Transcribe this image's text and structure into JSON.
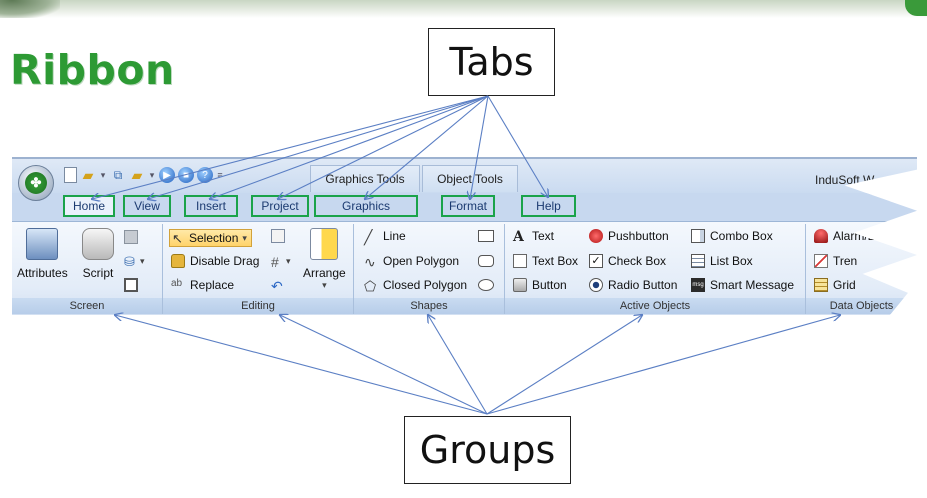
{
  "slide": {
    "title": "Ribbon",
    "callout_tabs": "Tabs",
    "callout_groups": "Groups"
  },
  "window": {
    "app_title": "InduSoft W",
    "context_tabs": [
      "Graphics Tools",
      "Object Tools"
    ]
  },
  "tabs": [
    "Home",
    "View",
    "Insert",
    "Project",
    "Graphics",
    "Format",
    "Help"
  ],
  "groups": {
    "screen": {
      "label": "Screen",
      "attributes": "Attributes",
      "script": "Script"
    },
    "editing": {
      "label": "Editing",
      "selection": "Selection",
      "disable_drag": "Disable Drag",
      "replace": "Replace",
      "arrange": "Arrange"
    },
    "shapes": {
      "label": "Shapes",
      "line": "Line",
      "open_polygon": "Open Polygon",
      "closed_polygon": "Closed Polygon"
    },
    "active_objects": {
      "label": "Active Objects",
      "text": "Text",
      "text_box": "Text Box",
      "button": "Button",
      "pushbutton": "Pushbutton",
      "check_box": "Check Box",
      "radio_button": "Radio Button",
      "combo_box": "Combo Box",
      "list_box": "List Box",
      "smart_message": "Smart Message"
    },
    "data_objects": {
      "label": "Data Objects",
      "alarm_event": "Alarm/Event",
      "trend": "Tren",
      "grid": "Grid"
    }
  },
  "colors": {
    "title_green": "#2d9a34",
    "tab_outline_green": "#1aa34a",
    "ribbon_blue": "#c7d8ef",
    "arrow_blue": "#5b7fc4"
  }
}
